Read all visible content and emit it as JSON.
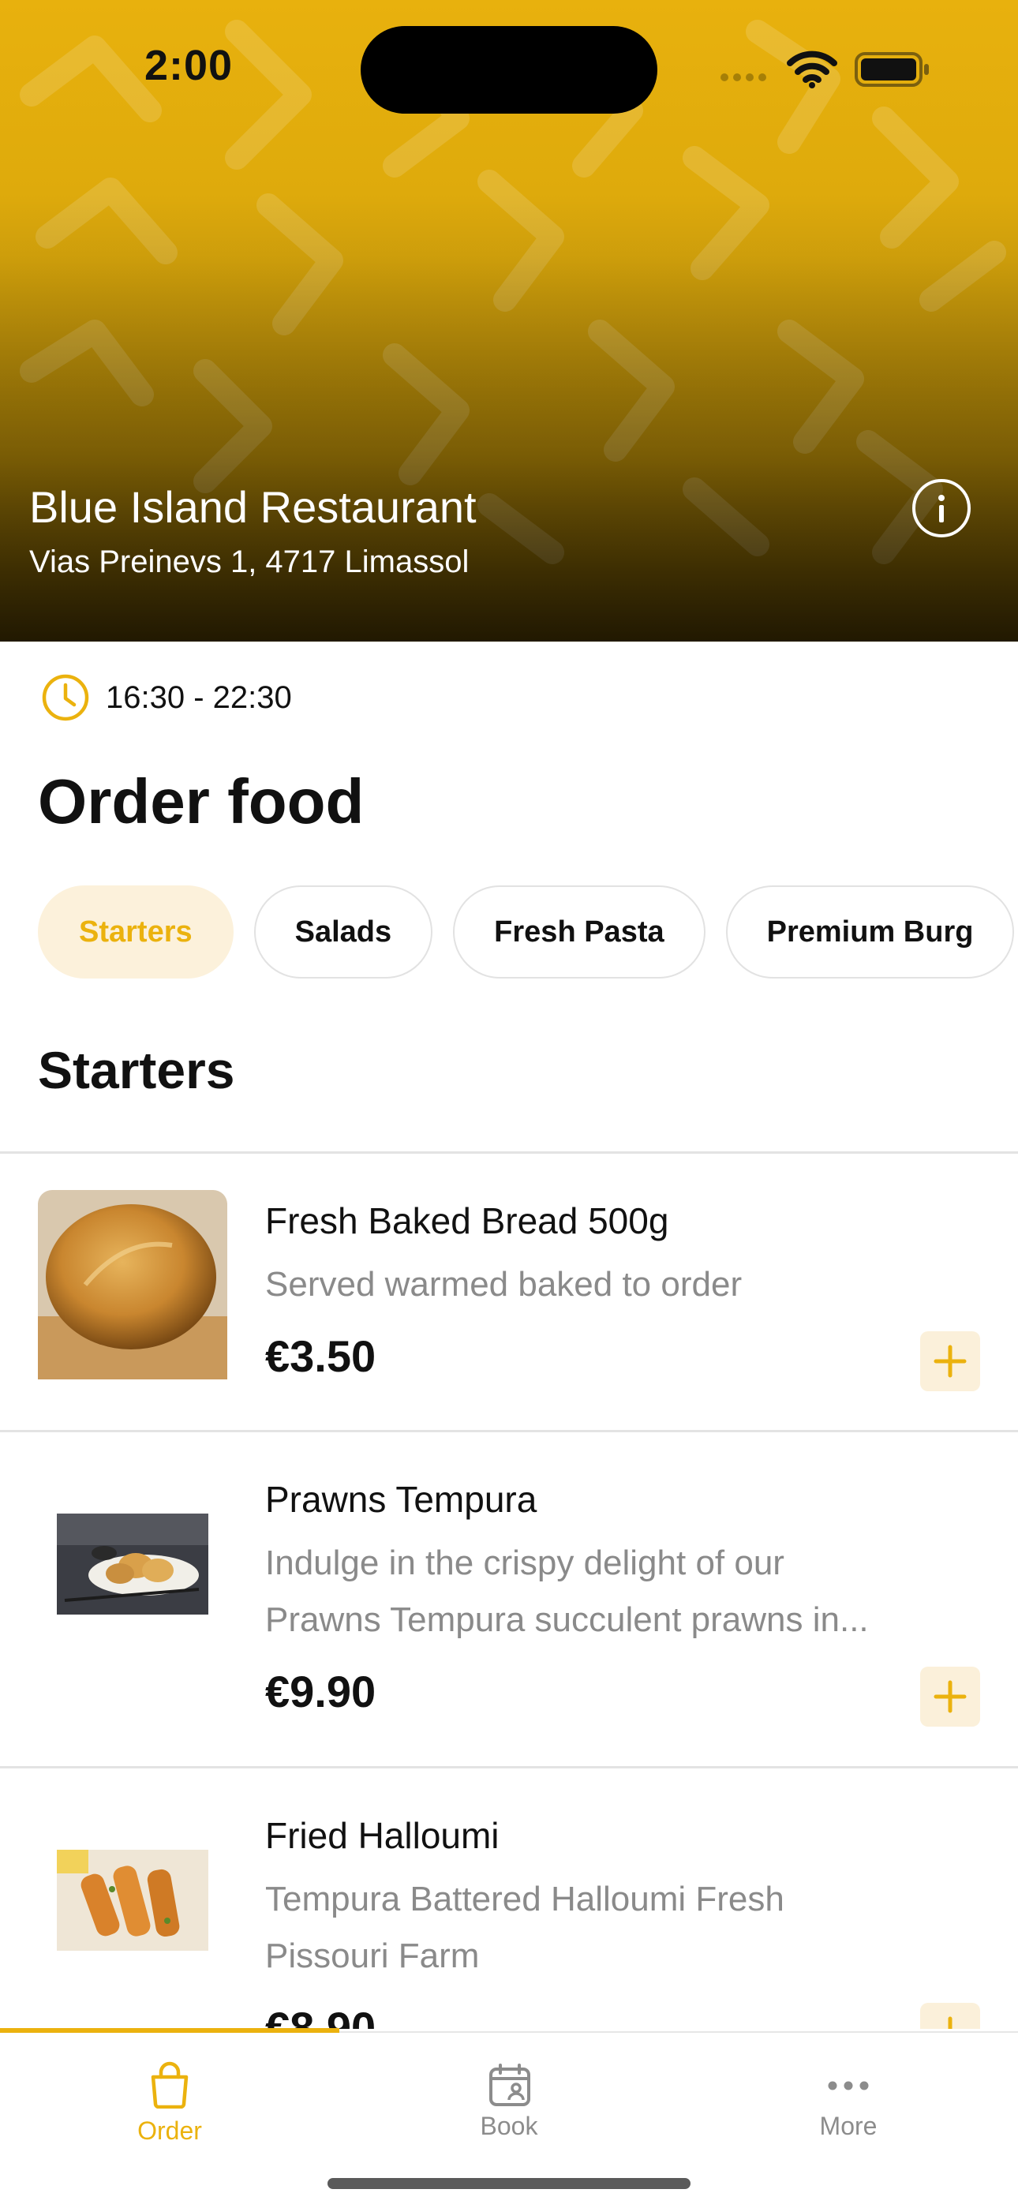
{
  "status_bar": {
    "time": "2:00"
  },
  "restaurant": {
    "name": "Blue Island Restaurant",
    "address": "Vias Preinevs 1, 4717 Limassol",
    "hours": "16:30 - 22:30"
  },
  "page": {
    "title": "Order food"
  },
  "categories": [
    {
      "label": "Starters",
      "active": true
    },
    {
      "label": "Salads",
      "active": false
    },
    {
      "label": "Fresh Pasta",
      "active": false
    },
    {
      "label": "Premium Burg",
      "active": false
    }
  ],
  "section": {
    "title": "Starters"
  },
  "items": [
    {
      "name": "Fresh Baked Bread 500g",
      "desc_lines": [
        "Served warmed baked to order"
      ],
      "price": "€3.50"
    },
    {
      "name": "Prawns Tempura",
      "desc_lines": [
        "Indulge in the crispy delight of our",
        "Prawns Tempura succulent prawns in..."
      ],
      "price": "€9.90"
    },
    {
      "name": "Fried Halloumi",
      "desc_lines": [
        "Tempura Battered Halloumi Fresh",
        "Pissouri Farm"
      ],
      "price": "€8.90"
    }
  ],
  "bottom_nav": [
    {
      "label": "Order",
      "icon": "bag-icon",
      "active": true
    },
    {
      "label": "Book",
      "icon": "calendar-person-icon",
      "active": false
    },
    {
      "label": "More",
      "icon": "more-dots-icon",
      "active": false
    }
  ],
  "colors": {
    "accent": "#ebb20e",
    "accent_soft": "#fcf1db",
    "hero": "#e8b10d"
  }
}
